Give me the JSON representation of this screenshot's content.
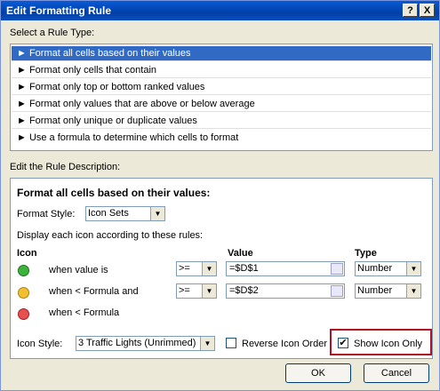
{
  "window": {
    "title": "Edit Formatting Rule",
    "help_button": "?",
    "close_button": "X"
  },
  "rule_type": {
    "heading": "Select a Rule Type:",
    "items": [
      "► Format all cells based on their values",
      "► Format only cells that contain",
      "► Format only top or bottom ranked values",
      "► Format only values that are above or below average",
      "► Format only unique or duplicate values",
      "► Use a formula to determine which cells to format"
    ],
    "selected_index": 0
  },
  "description": {
    "heading": "Edit the Rule Description:",
    "bold_title": "Format all cells based on their values:",
    "format_style_label": "Format Style:",
    "format_style_value": "Icon Sets",
    "instruction": "Display each icon according to these rules:",
    "columns": {
      "icon": "Icon",
      "value": "Value",
      "type": "Type"
    },
    "rules": [
      {
        "icon_color": "#3cb43c",
        "condition": "when value is",
        "operator": ">=",
        "value": "=$D$1",
        "type": "Number"
      },
      {
        "icon_color": "#f0c030",
        "condition": "when < Formula and",
        "operator": ">=",
        "value": "=$D$2",
        "type": "Number"
      },
      {
        "icon_color": "#e85050",
        "condition": "when < Formula"
      }
    ],
    "icon_style_label": "Icon Style:",
    "icon_style_value": "3 Traffic Lights (Unrimmed)",
    "reverse_label": "Reverse Icon Order",
    "reverse_checked": false,
    "show_icon_only_label": "Show Icon Only",
    "show_icon_only_checked": true
  },
  "buttons": {
    "ok": "OK",
    "cancel": "Cancel"
  },
  "colors": {
    "titlebar": "#0a4fbd",
    "selection": "#316ac5",
    "highlight_box": "#b01020"
  }
}
